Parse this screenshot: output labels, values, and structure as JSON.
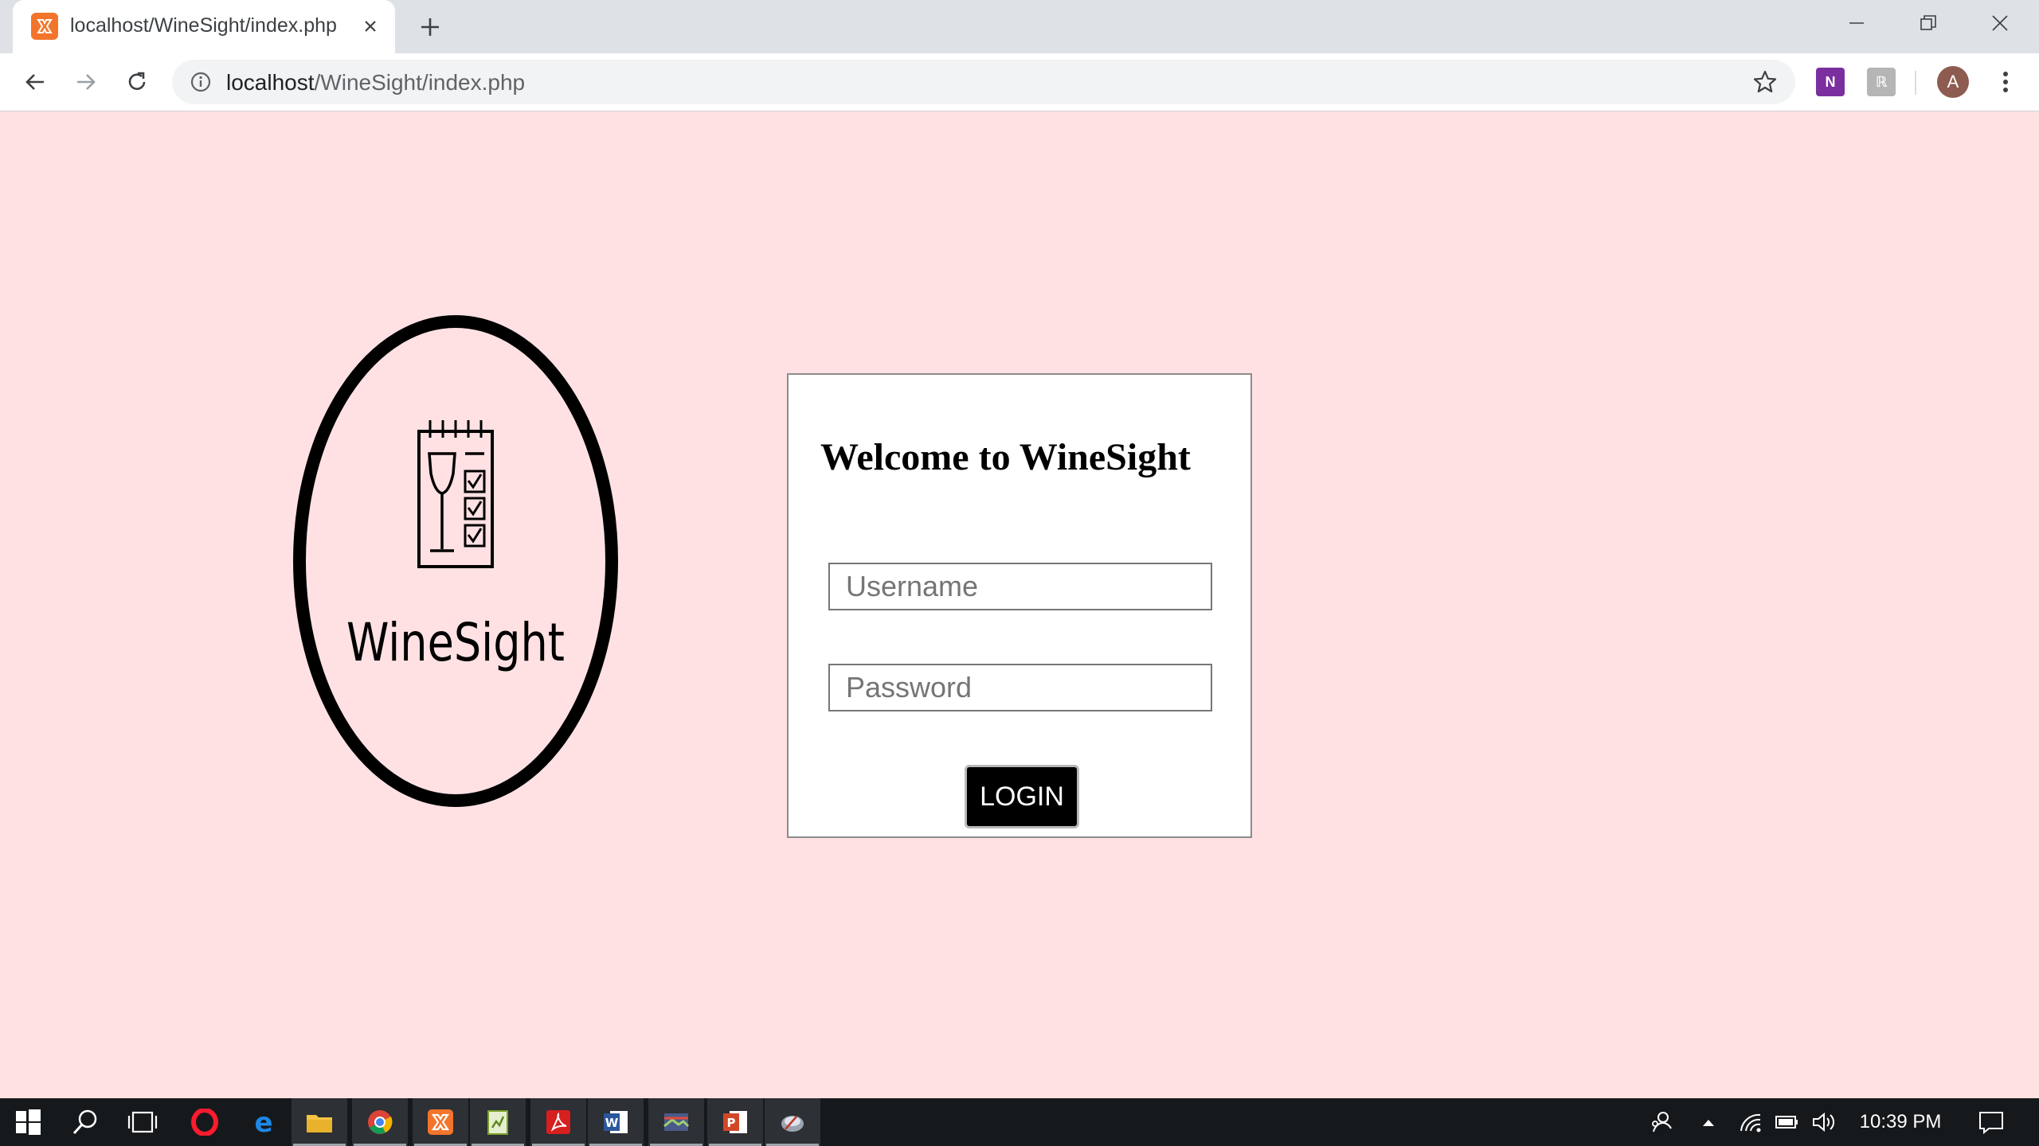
{
  "browser": {
    "tab_title": "localhost/WineSight/index.php",
    "url_host": "localhost",
    "url_path": "/WineSight/index.php",
    "profile_initial": "A"
  },
  "page": {
    "background": "#ffe1e3",
    "logo_text": "WineSight",
    "heading": "Welcome to WineSight",
    "username_placeholder": "Username",
    "password_placeholder": "Password",
    "login_label": "LOGIN"
  },
  "taskbar": {
    "clock": "10:39 PM",
    "apps": [
      "start-icon",
      "search-icon",
      "task-view-icon",
      "opera-icon",
      "edge-icon",
      "file-explorer-icon",
      "chrome-icon",
      "xampp-icon",
      "notepad-plus-icon",
      "acrobat-icon",
      "word-icon",
      "photos-icon",
      "powerpoint-icon",
      "app-icon"
    ]
  }
}
